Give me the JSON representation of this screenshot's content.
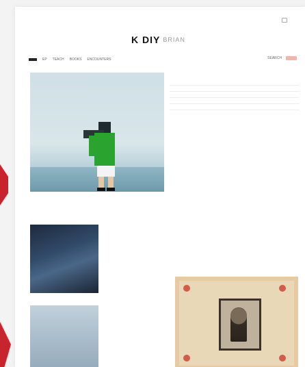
{
  "site": {
    "logo_mark": "K DIY",
    "logo_sub": "BRIAN"
  },
  "top_links": [
    "",
    "",
    "",
    ""
  ],
  "nav": {
    "items": [
      "",
      "EP",
      "TEACH",
      "BOOKS",
      "ENCOUNTERS"
    ],
    "search": "SEARCH",
    "subscribe": ""
  },
  "hero": {
    "caption": "",
    "sidebar_items": [
      "",
      "",
      "",
      "",
      ""
    ],
    "featured_title": "",
    "featured_meta": ""
  },
  "section_label": "",
  "cards": [
    {
      "title": "",
      "meta": "",
      "body": "",
      "more": ""
    },
    {
      "title": "",
      "meta": "",
      "body": "",
      "more": ""
    },
    {
      "title": "",
      "meta": "",
      "body": "",
      "more": ""
    }
  ],
  "colors": {
    "accent": "#e06b55",
    "brand_red": "#c8242e",
    "nav_active": "#222222"
  }
}
